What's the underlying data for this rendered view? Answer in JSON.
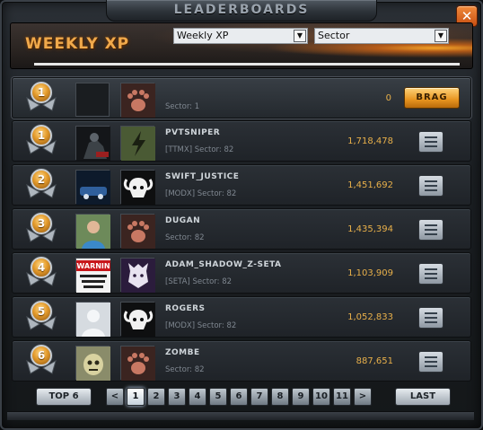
{
  "window": {
    "title": "LEADERBOARDS",
    "close_label": "✕"
  },
  "header": {
    "board_title": "WEEKLY XP",
    "metric_select": {
      "value": "Weekly XP"
    },
    "scope_select": {
      "value": "Sector"
    }
  },
  "current_player": {
    "rank": "1",
    "name": "",
    "sector": "Sector: 1",
    "xp": "0",
    "brag_label": "BRAG",
    "emblem_icon": "bear-paw-icon"
  },
  "rows": [
    {
      "rank": "1",
      "name": "PVTSNIPER",
      "sector": "[TTMX] Sector: 82",
      "xp": "1,718,478",
      "emblem_icon": "lightning-icon"
    },
    {
      "rank": "2",
      "name": "SWIFT_JUSTICE",
      "sector": "[MODX] Sector: 82",
      "xp": "1,451,692",
      "emblem_icon": "ram-skull-icon"
    },
    {
      "rank": "3",
      "name": "DUGAN",
      "sector": "Sector: 82",
      "xp": "1,435,394",
      "emblem_icon": "bear-paw-icon"
    },
    {
      "rank": "4",
      "name": "ADAM_SHADOW_Z-SETA",
      "sector": "[SETA] Sector: 82",
      "xp": "1,103,909",
      "emblem_icon": "wolf-head-icon"
    },
    {
      "rank": "5",
      "name": "ROGERS",
      "sector": "[MODX] Sector: 82",
      "xp": "1,052,833",
      "emblem_icon": "ram-skull-icon"
    },
    {
      "rank": "6",
      "name": "ZOMBE",
      "sector": "Sector: 82",
      "xp": "887,651",
      "emblem_icon": "bear-paw-icon"
    }
  ],
  "avatars": {
    "r1": "WARNING",
    "r4": "WARNIN"
  },
  "footer": {
    "top_label": "TOP 6",
    "prev_label": "<",
    "next_label": ">",
    "last_label": "LAST",
    "pages": [
      "1",
      "2",
      "3",
      "4",
      "5",
      "6",
      "7",
      "8",
      "9",
      "10",
      "11"
    ],
    "current_page": "1"
  },
  "colors": {
    "accent_orange": "#f0a94b",
    "xp_gold": "#e8b04a"
  }
}
